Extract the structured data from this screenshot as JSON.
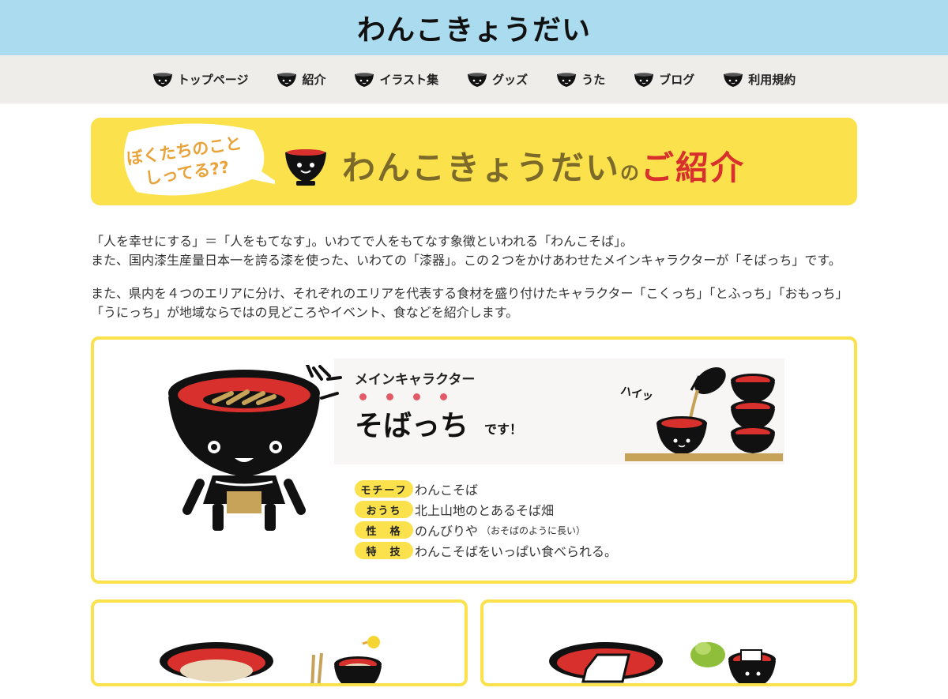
{
  "header": {
    "site_title": "わんこきょうだい"
  },
  "nav": {
    "items": [
      {
        "label": "トップページ",
        "icon": "bowl-face-icon"
      },
      {
        "label": "紹介",
        "icon": "bowl-face-icon"
      },
      {
        "label": "イラスト集",
        "icon": "bowl-face-icon"
      },
      {
        "label": "グッズ",
        "icon": "bowl-face-icon"
      },
      {
        "label": "うた",
        "icon": "bowl-face-icon"
      },
      {
        "label": "ブログ",
        "icon": "bowl-face-icon"
      },
      {
        "label": "利用規約",
        "icon": "bowl-face-icon"
      }
    ]
  },
  "banner": {
    "bubble_line1": "ぼくたちのこと",
    "bubble_line2": "しってる??",
    "title_main": "わんこきょうだい",
    "title_no": "の",
    "title_red": "ご紹介"
  },
  "intro": {
    "p1": "「人を幸せにする」＝「人をもてなす」。いわてで人をもてなす象徴といわれる「わんこそば」。\nまた、国内漆生産量日本一を誇る漆を使った、いわての「漆器」。この２つをかけあわせたメインキャラクターが「そばっち」です。",
    "p2": "また、県内を４つのエリアに分け、それぞれのエリアを代表する食材を盛り付けたキャラクター「こくっち」「とふっち」「おもっち」「うにっち」が地域ならではの見どころやイベント、食などを紹介します。"
  },
  "main_character": {
    "kicker": "メインキャラクター",
    "name": "そばっち",
    "suffix": "です！",
    "art_text": "ハイッ",
    "profile": [
      {
        "label": "モチーフ",
        "value": "わんこそば",
        "note": ""
      },
      {
        "label": "おうち",
        "value": "北上山地のとあるそば畑",
        "note": ""
      },
      {
        "label": "性　格",
        "value": "のんびりや",
        "note": "（おそばのように長い）"
      },
      {
        "label": "特　技",
        "value": "わんこそばをいっぱい食べられる。",
        "note": ""
      }
    ]
  },
  "colors": {
    "header_bg": "#aadbee",
    "nav_bg": "#efede9",
    "accent_yellow": "#fbe14b",
    "bowl_red": "#d8302c",
    "dot_pink": "#e35a66"
  }
}
